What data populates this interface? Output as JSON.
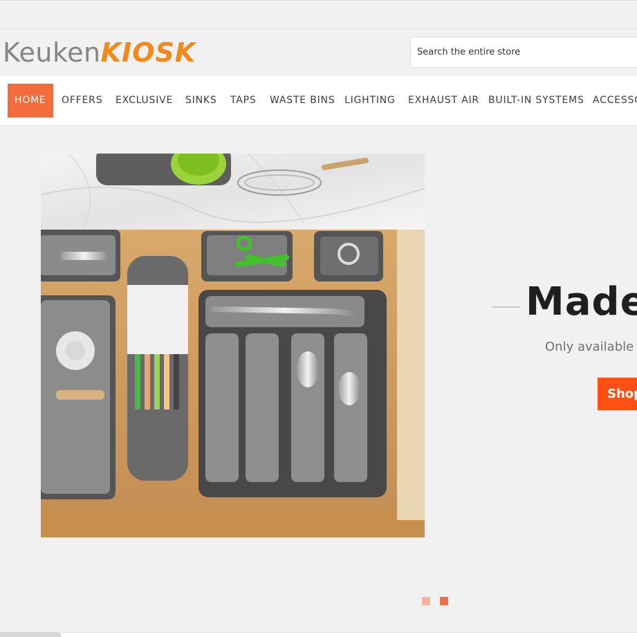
{
  "brand": {
    "part1": "Keuken",
    "part2": "KIOSK"
  },
  "search": {
    "placeholder": "Search the entire store"
  },
  "nav": {
    "items": [
      {
        "label": "HOME",
        "active": true
      },
      {
        "label": "OFFERS"
      },
      {
        "label": "EXCLUSIVE"
      },
      {
        "label": "SINKS"
      },
      {
        "label": "TAPS"
      },
      {
        "label": "WASTE BINS"
      },
      {
        "label": "LIGHTING"
      },
      {
        "label": "EXHAUST AIR"
      },
      {
        "label": "BUILT-IN SYSTEMS"
      },
      {
        "label": "ACCESSORIES"
      }
    ]
  },
  "hero": {
    "headline": "Made",
    "subline": "Only available",
    "cta": "Shop",
    "slides": {
      "count": 2,
      "active": 2
    }
  },
  "colors": {
    "accent": "#f26c3e",
    "cta": "#ff4f13",
    "logo_orange": "#f08a1c",
    "dot_inactive": "#f2b49e",
    "dot_active": "#f07047"
  }
}
